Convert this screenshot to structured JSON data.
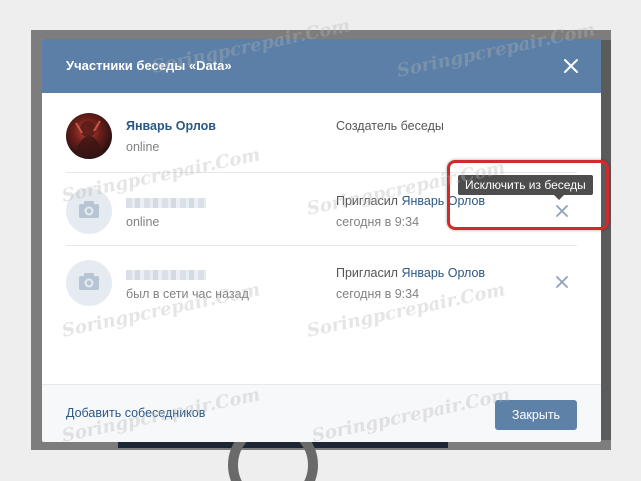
{
  "modal": {
    "title": "Участники беседы «Data»",
    "close_icon": "close-icon"
  },
  "members": [
    {
      "name": "Январь Орлов",
      "status": "online",
      "role": "Создатель беседы",
      "avatar": "user-photo"
    },
    {
      "name_hidden": true,
      "status": "online",
      "role_prefix": "Пригласил",
      "inviter": "Январь Орлов",
      "time": "сегодня в 9:34",
      "avatar": "camera-icon",
      "remove_icon": "close-icon"
    },
    {
      "name_hidden": true,
      "status": "был в сети час назад",
      "role_prefix": "Пригласил",
      "inviter": "Январь Орлов",
      "time": "сегодня в 9:34",
      "avatar": "camera-icon",
      "remove_icon": "close-icon"
    }
  ],
  "tooltip": {
    "text": "Исключить из беседы"
  },
  "footer": {
    "add_label": "Добавить собеседников",
    "close_label": "Закрыть"
  },
  "watermark": "Soringpcrepair.Com",
  "colors": {
    "header": "#5b7fa6",
    "link": "#2a5885",
    "button": "#5e81a8",
    "highlight": "#d12a2a"
  }
}
